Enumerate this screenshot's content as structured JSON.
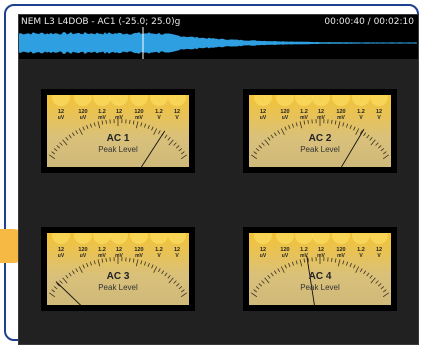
{
  "waveform": {
    "title": "NEM L3 L4DOB - AC1 (-25.0; 25.0)g",
    "time": "00:00:40 / 00:02:10",
    "progress": 0.31,
    "color": "#2e9fe0"
  },
  "scale": {
    "values": [
      "12",
      "120",
      "1.2",
      "12",
      "120",
      "1.2",
      "12"
    ],
    "units": [
      "uV",
      "uV",
      "mV",
      "mV",
      "mV",
      "V",
      "V"
    ]
  },
  "meters": [
    {
      "name": "AC 1",
      "label": "Peak Level",
      "needle": 0.8
    },
    {
      "name": "AC 2",
      "label": "Peak Level",
      "needle": 0.78
    },
    {
      "name": "AC 3",
      "label": "Peak Level",
      "needle": 0.08
    },
    {
      "name": "AC 4",
      "label": "Peak Level",
      "needle": 0.42
    }
  ],
  "colors": {
    "accent": "#f5b944",
    "frame": "#1f3f8f"
  }
}
